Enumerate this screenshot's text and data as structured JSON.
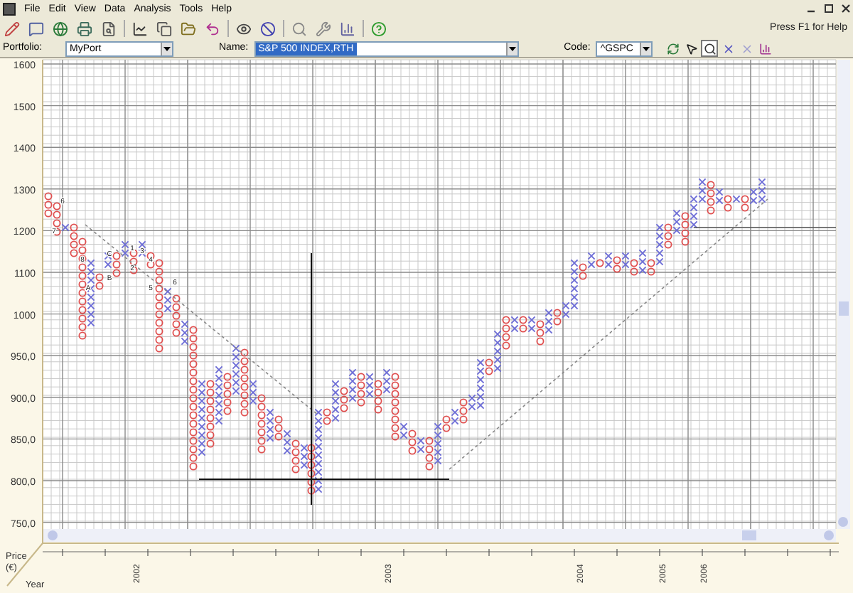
{
  "menu": [
    "File",
    "Edit",
    "View",
    "Data",
    "Analysis",
    "Tools",
    "Help"
  ],
  "status_hint": "Press F1 for Help",
  "portfolio": {
    "label": "Portfolio:",
    "value": "MyPort"
  },
  "name": {
    "label": "Name:",
    "value": "S&P 500 INDEX,RTH"
  },
  "code": {
    "label": "Code:",
    "value": "^GSPC"
  },
  "chart_tools": [
    {
      "selected": false
    },
    {
      "selected": false
    },
    {
      "selected": true
    },
    {
      "selected": false
    },
    {
      "selected": false
    },
    {
      "selected": false
    }
  ],
  "y_axis_labels": [
    "1600",
    "1500",
    "1400",
    "1300",
    "1200",
    "1100",
    "1000",
    "950,0",
    "900,0",
    "850,0",
    "800,0",
    "750,0"
  ],
  "x_axis_labels": [
    "2002",
    "2003",
    "2004",
    "2005",
    "2006"
  ],
  "price_label": "Price",
  "price_unit": "(€)",
  "year_label": "Year",
  "month_marks": [
    "6",
    "7",
    "8",
    "A",
    "B",
    "C",
    "1",
    "2",
    "3",
    "4",
    "5",
    "6"
  ]
}
